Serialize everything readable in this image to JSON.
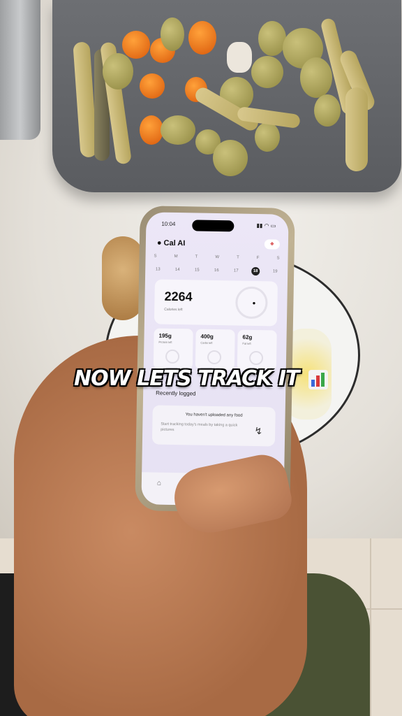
{
  "caption": "NOW LETS TRACK IT",
  "caption_emoji": "bar-chart-emoji",
  "phone": {
    "status_time": "10:04",
    "app_title": "Cal AI",
    "weekdays": [
      "S",
      "M",
      "T",
      "W",
      "T",
      "F",
      "S"
    ],
    "dates": [
      "13",
      "14",
      "15",
      "16",
      "17",
      "18",
      "19"
    ],
    "selected_date": "18",
    "calories": {
      "value": "2264",
      "label": "Calories left"
    },
    "macros": [
      {
        "value": "195g",
        "label": "Protein left"
      },
      {
        "value": "400g",
        "label": "Carbs left"
      },
      {
        "value": "62g",
        "label": "Fat left"
      }
    ],
    "recent_title": "Recently logged",
    "empty_title": "You haven't uploaded any food",
    "empty_body": "Start tracking today's meals by taking a quick pictures",
    "tabs": [
      "home-icon",
      "analytics-icon"
    ]
  }
}
